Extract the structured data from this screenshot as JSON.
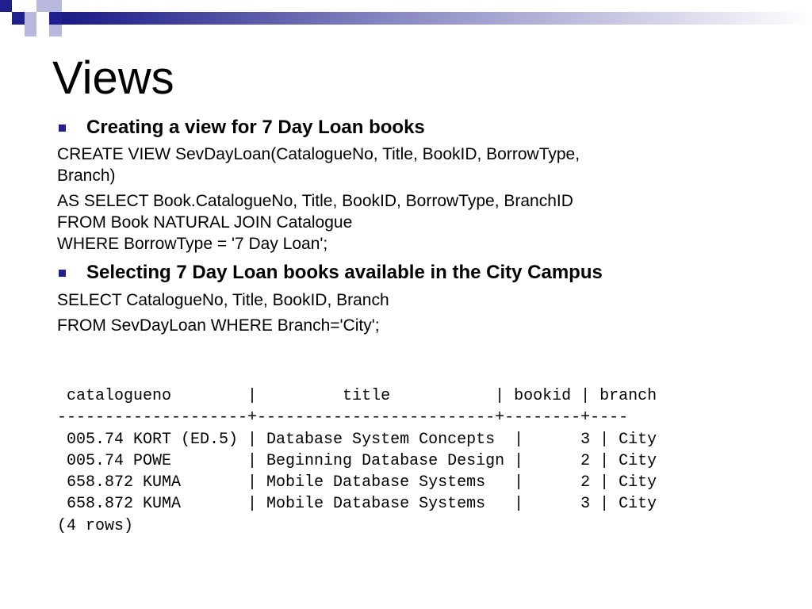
{
  "title": "Views",
  "colors": {
    "accent": "#1f1f8f",
    "accent_light": "#9090c8"
  },
  "bullets": [
    {
      "heading": "Creating a view for  7 Day Loan books",
      "paragraphs": [
        [
          "CREATE VIEW SevDayLoan(CatalogueNo, Title, BookID, BorrowType,",
          "Branch)"
        ],
        [
          "AS SELECT Book.CatalogueNo, Title, BookID, BorrowType, BranchID",
          "FROM Book NATURAL JOIN Catalogue",
          "WHERE BorrowType = '7 Day Loan';"
        ]
      ]
    },
    {
      "heading": "Selecting 7 Day Loan books available in the City Campus",
      "paragraphs": [
        [
          "SELECT CatalogueNo, Title, BookID, Branch"
        ],
        [
          "FROM SevDayLoan WHERE Branch='City';"
        ]
      ]
    }
  ],
  "result": {
    "header": " catalogueno        |         title           | bookid | branch",
    "separator": "--------------------+-------------------------+--------+----",
    "rows": [
      " 005.74 KORT (ED.5) | Database System Concepts  |      3 | City",
      " 005.74 POWE        | Beginning Database Design |      2 | City",
      " 658.872 KUMA       | Mobile Database Systems   |      2 | City",
      " 658.872 KUMA       | Mobile Database Systems   |      3 | City"
    ],
    "footer": "(4 rows)"
  }
}
